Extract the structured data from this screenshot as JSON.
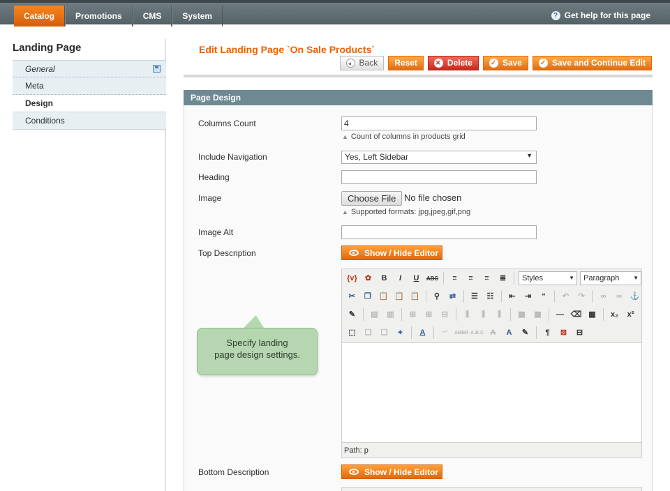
{
  "nav": {
    "items": [
      "Catalog",
      "Promotions",
      "CMS",
      "System"
    ],
    "help": "Get help for this page"
  },
  "sidebar": {
    "title": "Landing Page",
    "tabs": [
      "General",
      "Meta",
      "Design",
      "Conditions"
    ]
  },
  "header": {
    "title": "Edit Landing Page `On Sale Products`",
    "buttons": {
      "back": "Back",
      "reset": "Reset",
      "delete": "Delete",
      "save": "Save",
      "save_continue": "Save and Continue Edit"
    }
  },
  "section": {
    "title": "Page Design",
    "columns_count": {
      "label": "Columns Count",
      "value": "4",
      "note": "Count of columns in products grid"
    },
    "include_navigation": {
      "label": "Include Navigation",
      "value": "Yes, Left Sidebar"
    },
    "heading": {
      "label": "Heading",
      "value": ""
    },
    "image": {
      "label": "Image",
      "button": "Choose File",
      "status": "No file chosen",
      "note": "Supported formats: jpg,jpeg,gif,png"
    },
    "image_alt": {
      "label": "Image Alt",
      "value": ""
    },
    "top_description": {
      "label": "Top Description",
      "toggle": "Show / Hide Editor"
    },
    "bottom_description": {
      "label": "Bottom Description",
      "toggle": "Show / Hide Editor"
    }
  },
  "editor": {
    "styles_dropdown": "Styles",
    "format_dropdown": "Paragraph",
    "path": "Path: p"
  },
  "callout": {
    "line1": "Specify landing",
    "line2": "page design settings."
  },
  "colors": {
    "accent": "#eb5e00",
    "section_header": "#6f8992",
    "callout": "#b5d6b0"
  }
}
